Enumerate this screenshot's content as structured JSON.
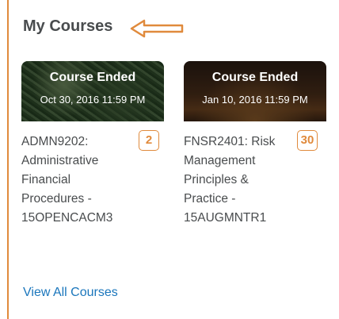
{
  "widget": {
    "title": "My Courses",
    "accent_color": "#e08a3c",
    "view_all_label": "View All Courses"
  },
  "courses": [
    {
      "status": "Course Ended",
      "date": "Oct 30, 2016 11:59 PM",
      "name": "ADMN9202: Administrative Financial Procedures - 15OPENCACM3",
      "badge": "2"
    },
    {
      "status": "Course Ended",
      "date": "Jan 10, 2016 11:59 PM",
      "name": "FNSR2401: Risk Management Principles & Practice - 15AUGMNTR1",
      "badge": "30"
    }
  ]
}
